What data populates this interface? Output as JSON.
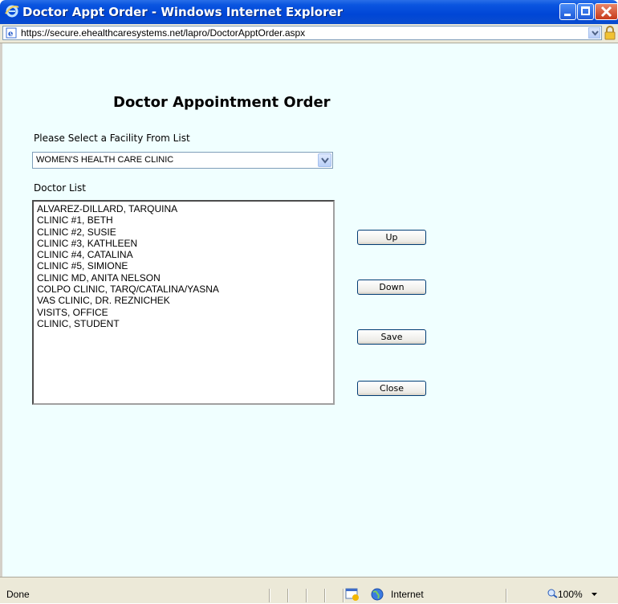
{
  "window": {
    "title": "Doctor Appt Order - Windows Internet Explorer",
    "address": "https://secure.ehealthcaresystems.net/lapro/DoctorApptOrder.aspx"
  },
  "page": {
    "heading": "Doctor Appointment Order",
    "facility_label": "Please Select a Facility From List",
    "facility_selected": "WOMEN'S HEALTH CARE CLINIC",
    "doctor_list_label": "Doctor List",
    "doctors": [
      "ALVAREZ-DILLARD, TARQUINA",
      "CLINIC #1, BETH",
      "CLINIC #2, SUSIE",
      "CLINIC #3, KATHLEEN",
      "CLINIC #4, CATALINA",
      "CLINIC #5, SIMIONE",
      "CLINIC MD, ANITA NELSON",
      "COLPO CLINIC, TARQ/CATALINA/YASNA",
      "VAS CLINIC, DR. REZNICHEK",
      "VISITS, OFFICE",
      "CLINIC, STUDENT"
    ],
    "buttons": {
      "up": "Up",
      "down": "Down",
      "save": "Save",
      "close": "Close"
    }
  },
  "statusbar": {
    "status": "Done",
    "zone": "Internet",
    "zoom": "100%"
  },
  "colors": {
    "page_background": "#f0ffff",
    "titlebar": "#0046d6"
  }
}
